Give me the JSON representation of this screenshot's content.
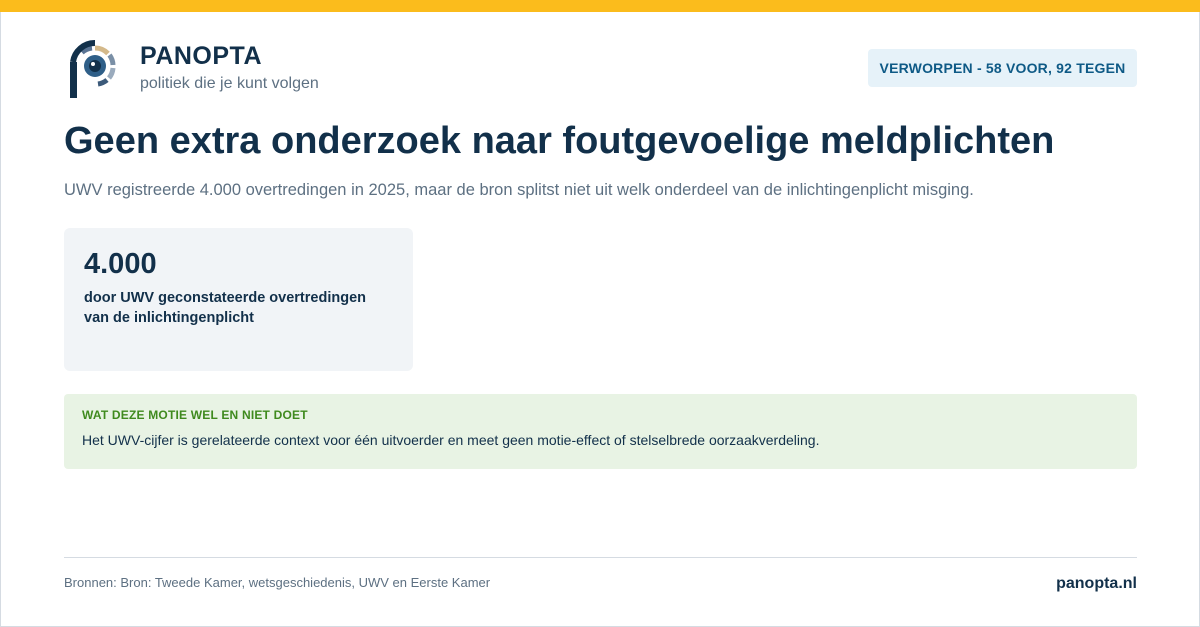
{
  "brand": {
    "name": "PANOPTA",
    "tagline": "politiek die je kunt volgen",
    "colors": {
      "accent": "#fbbc1c",
      "navy": "#12304a",
      "muted": "#5d7082"
    }
  },
  "vote_badge": "VERWORPEN - 58 VOOR, 92 TEGEN",
  "headline": "Geen extra onderzoek naar foutgevoelige meldplichten",
  "subhead": "UWV registreerde 4.000 overtredingen in 2025, maar de bron splitst niet uit welk onderdeel van de inlichtingenplicht misging.",
  "stat": {
    "value": "4.000",
    "label": "door UWV geconstateerde overtredingen van de inlichtingenplicht"
  },
  "info": {
    "title": "WAT DEZE MOTIE WEL EN NIET DOET",
    "text": "Het UWV-cijfer is gerelateerde context voor één uitvoerder en meet geen motie-effect of stelselbrede oorzaakverdeling."
  },
  "footer": {
    "sources": "Bronnen: Bron: Tweede Kamer, wetsgeschiedenis, UWV en Eerste Kamer",
    "site": "panopta.nl"
  }
}
